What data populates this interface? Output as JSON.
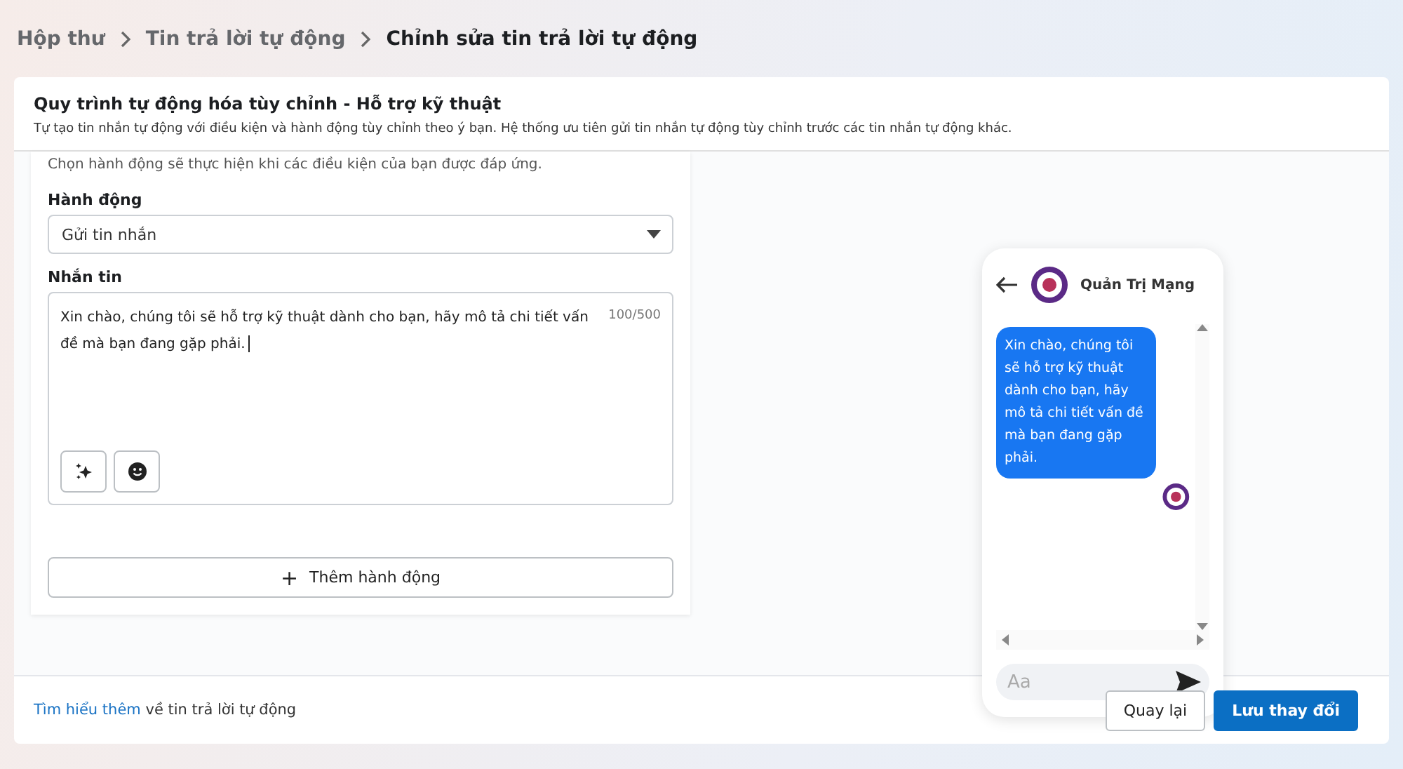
{
  "breadcrumb": [
    {
      "label": "Hộp thư",
      "current": false
    },
    {
      "label": "Tin trả lời tự động",
      "current": false
    },
    {
      "label": "Chỉnh sửa tin trả lời tự động",
      "current": true
    }
  ],
  "header": {
    "title": "Quy trình tự động hóa tùy chỉnh - Hỗ trợ kỹ thuật",
    "description": "Tự tạo tin nhắn tự động với điều kiện và hành động tùy chỉnh theo ý bạn. Hệ thống ưu tiên gửi tin nhắn tự động tùy chỉnh trước các tin nhắn tự động khác."
  },
  "form": {
    "hint": "Chọn hành động sẽ thực hiện khi các điều kiện của bạn được đáp ứng.",
    "action_label": "Hành động",
    "action_value": "Gửi tin nhắn",
    "message_label": "Nhắn tin",
    "message_value": "Xin chào, chúng tôi sẽ hỗ trợ kỹ thuật dành cho bạn, hãy mô tả chi tiết vấn đề mà bạn đang gặp phải.",
    "counter": "100/500",
    "add_button": "Thêm hành động",
    "add_icon": "+"
  },
  "preview": {
    "page_name": "Quản Trị Mạng",
    "bubble": "Xin chào, chúng tôi sẽ hỗ trợ kỹ thuật dành cho bạn, hãy mô tả chi tiết vấn đề mà bạn đang gặp phải.",
    "input_placeholder": "Aa"
  },
  "footer": {
    "link": "Tìm hiểu thêm",
    "text": "về tin trả lời tự động",
    "buttons": [
      {
        "label": "Quay lại",
        "kind": "secondary"
      },
      {
        "label": "Lưu thay đổi",
        "kind": "primary"
      }
    ]
  }
}
